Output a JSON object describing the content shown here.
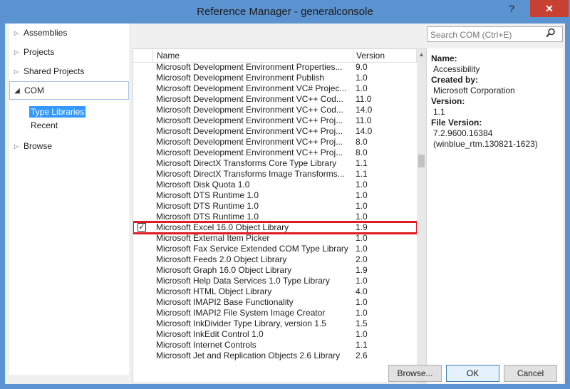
{
  "window": {
    "title": "Reference Manager - generalconsole",
    "help": "?",
    "close": "✕"
  },
  "nav": {
    "items": [
      {
        "label": "Assemblies",
        "arrow": "▷"
      },
      {
        "label": "Projects",
        "arrow": "▷"
      },
      {
        "label": "Shared Projects",
        "arrow": "▷"
      },
      {
        "label": "COM",
        "arrow": "◢"
      },
      {
        "label": "Browse",
        "arrow": "▷"
      }
    ],
    "com_sub": [
      {
        "label": "Type Libraries"
      },
      {
        "label": "Recent"
      }
    ]
  },
  "grid": {
    "columns": {
      "name": "Name",
      "version": "Version"
    },
    "rows": [
      {
        "name": "Microsoft Development Environment Properties...",
        "version": "9.0"
      },
      {
        "name": "Microsoft Development Environment Publish",
        "version": "1.0"
      },
      {
        "name": "Microsoft Development Environment VC# Projec...",
        "version": "1.0"
      },
      {
        "name": "Microsoft Development Environment VC++ Cod...",
        "version": "11.0"
      },
      {
        "name": "Microsoft Development Environment VC++ Cod...",
        "version": "14.0"
      },
      {
        "name": "Microsoft Development Environment VC++ Proj...",
        "version": "11.0"
      },
      {
        "name": "Microsoft Development Environment VC++ Proj...",
        "version": "14.0"
      },
      {
        "name": "Microsoft Development Environment VC++ Proj...",
        "version": "8.0"
      },
      {
        "name": "Microsoft Development Environment VC++ Proj...",
        "version": "8.0"
      },
      {
        "name": "Microsoft DirectX Transforms Core Type Library",
        "version": "1.1"
      },
      {
        "name": "Microsoft DirectX Transforms Image Transforms...",
        "version": "1.1"
      },
      {
        "name": "Microsoft Disk Quota 1.0",
        "version": "1.0"
      },
      {
        "name": "Microsoft DTS Runtime 1.0",
        "version": "1.0"
      },
      {
        "name": "Microsoft DTS Runtime 1.0",
        "version": "1.0"
      },
      {
        "name": "Microsoft DTS Runtime 1.0",
        "version": "1.0"
      },
      {
        "name": "Microsoft Excel 16.0 Object Library",
        "version": "1.9",
        "checked": true
      },
      {
        "name": "Microsoft External Item Picker",
        "version": "1.0"
      },
      {
        "name": "Microsoft Fax Service Extended COM Type Library",
        "version": "1.0"
      },
      {
        "name": "Microsoft Feeds 2.0 Object Library",
        "version": "2.0"
      },
      {
        "name": "Microsoft Graph 16.0 Object Library",
        "version": "1.9"
      },
      {
        "name": "Microsoft Help Data Services 1.0 Type Library",
        "version": "1.0"
      },
      {
        "name": "Microsoft HTML Object Library",
        "version": "4.0"
      },
      {
        "name": "Microsoft IMAPI2 Base Functionality",
        "version": "1.0"
      },
      {
        "name": "Microsoft IMAPI2 File System Image Creator",
        "version": "1.0"
      },
      {
        "name": "Microsoft InkDivider Type Library, version 1.5",
        "version": "1.5"
      },
      {
        "name": "Microsoft InkEdit Control 1.0",
        "version": "1.0"
      },
      {
        "name": "Microsoft Internet Controls",
        "version": "1.1"
      },
      {
        "name": "Microsoft Jet and Replication Objects 2.6 Library",
        "version": "2.6"
      }
    ]
  },
  "search": {
    "placeholder": "Search COM (Ctrl+E)",
    "icon": "search-icon"
  },
  "details": {
    "name_label": "Name:",
    "name_value": "Accessibility",
    "created_label": "Created by:",
    "created_value": "Microsoft Corporation",
    "version_label": "Version:",
    "version_value": "1.1",
    "file_version_label": "File Version:",
    "file_version_value": "7.2.9600.16384",
    "file_version_extra": "(winblue_rtm.130821-1623)"
  },
  "buttons": {
    "browse": "Browse...",
    "ok": "OK",
    "cancel": "Cancel"
  },
  "colors": {
    "title_bar": "#5b92d0",
    "close": "#c84031",
    "highlight": "#e01b24",
    "selection": "#3399ff"
  }
}
